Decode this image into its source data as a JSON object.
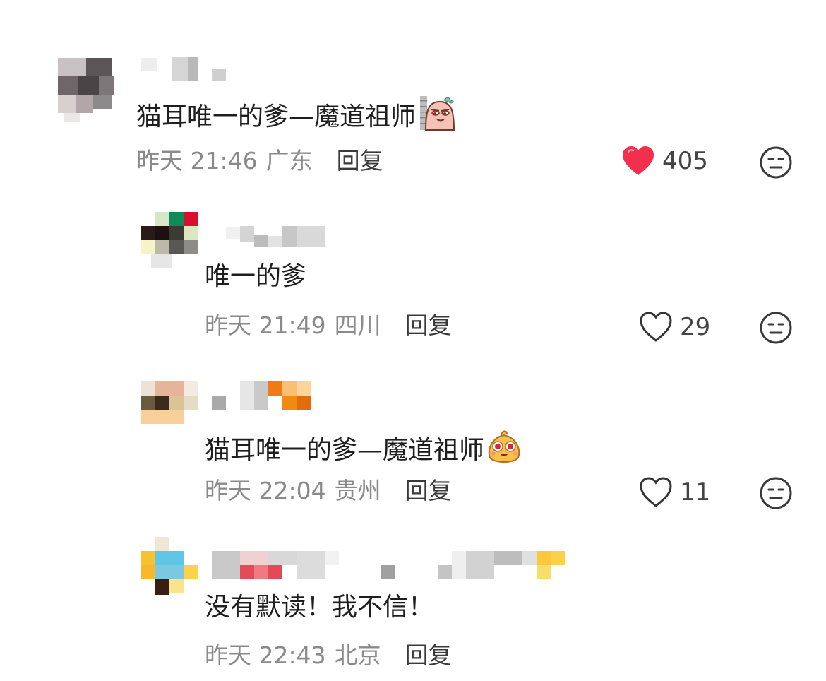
{
  "colors": {
    "liked_heart": "#f2304e",
    "meta_text": "#8a8a8a",
    "body_text": "#1e1e1e",
    "reply_text": "#3a3a3a"
  },
  "comments": [
    {
      "level": "top",
      "text": "猫耳唯一的爹—魔道祖师",
      "emoji": "peeking-sausage-emoji",
      "time": "昨天 21:46",
      "location": "广东",
      "reply_label": "回复",
      "likes": "405",
      "liked": true
    },
    {
      "level": "reply",
      "text": "唯一的爹",
      "time": "昨天 21:49",
      "location": "四川",
      "reply_label": "回复",
      "likes": "29",
      "liked": false
    },
    {
      "level": "reply",
      "text": "猫耳唯一的爹—魔道祖师",
      "emoji": "excited-blob-emoji",
      "time": "昨天 22:04",
      "location": "贵州",
      "reply_label": "回复",
      "likes": "11",
      "liked": false
    },
    {
      "level": "reply",
      "text": "没有默读！我不信！",
      "time": "昨天 22:43",
      "location": "北京",
      "reply_label": "回复"
    }
  ]
}
